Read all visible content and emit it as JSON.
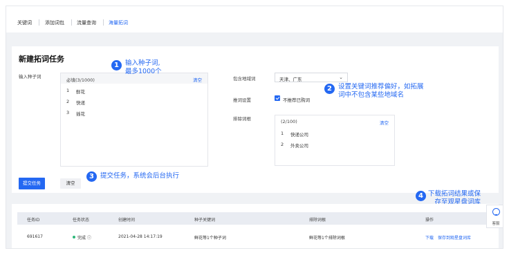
{
  "nav": {
    "tabs": [
      "关键词",
      "添加词包",
      "流量查询",
      "海量拓词"
    ],
    "active_index": 3
  },
  "task": {
    "title": "新建拓词任务",
    "seed_label": "输入种子词",
    "seed_count": "必填(3/1000)",
    "clear": "清空",
    "seeds": [
      {
        "n": "1",
        "t": "鲜花"
      },
      {
        "n": "2",
        "t": "快递"
      },
      {
        "n": "3",
        "t": "插花"
      }
    ],
    "region_label": "包含地域词",
    "region_value": "天津、广东",
    "recommend_label": "推词设置",
    "recommend_option": "不推荐已购词",
    "exclude_label": "排除词根",
    "exclude_count": "(2/100)",
    "excludes": [
      {
        "n": "1",
        "t": "快递公司"
      },
      {
        "n": "2",
        "t": "外卖公司"
      }
    ],
    "submit": "提交任务",
    "reset": "清空"
  },
  "annotations": [
    {
      "num": "1",
      "lines": [
        "输入种子词,",
        "最多1000个"
      ]
    },
    {
      "num": "2",
      "lines": [
        "设置关键词推荐偏好，如拓展",
        "词中不包含某些地域名"
      ]
    },
    {
      "num": "3",
      "lines": [
        "提交任务，系统会后台执行"
      ]
    },
    {
      "num": "4",
      "lines": [
        "下载拓词结果或保",
        "存至观星盘词库"
      ]
    }
  ],
  "table": {
    "headers": [
      "任务ID",
      "任务状态",
      "创建时间",
      "种子关键词",
      "排除词根",
      "操作"
    ],
    "row": {
      "id": "691617",
      "status": "完成",
      "status_info": "ⓘ",
      "created": "2021-04-28 14:17:19",
      "seed": "鲜花等1个种子词",
      "exclude": "鲜花等1个排除词根",
      "download": "下载",
      "save": "保存到观星盘词库"
    }
  },
  "service": {
    "label": "客服",
    "icon": "headset-icon"
  },
  "colors": {
    "accent": "#2468f2",
    "success": "#2eb87a"
  }
}
